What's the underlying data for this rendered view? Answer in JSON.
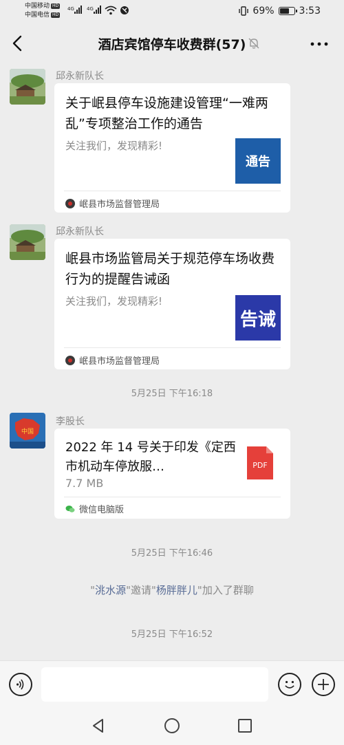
{
  "status": {
    "carrier1": "中国移动",
    "carrier2": "中国电信",
    "hd_badge": "HD",
    "network1": "4G",
    "network2": "4G",
    "vibrate_icon": "vibrate-icon",
    "battery_percent": "69%",
    "battery_level": 0.69,
    "time": "3:53"
  },
  "header": {
    "title": "酒店宾馆停车收费群(57)",
    "back_icon": "chevron-left-icon",
    "mute_icon": "bell-muted-icon",
    "more_icon": "more-dots-icon"
  },
  "messages": [
    {
      "sender": "邱永新队长",
      "title": "关于岷县停车设施建设管理“一难两乱”专项整治工作的通告",
      "desc": "关注我们，发现精彩!",
      "thumb_text": "通告",
      "thumb_color": "#1e5ea8",
      "source": "岷县市场监督管理局"
    },
    {
      "sender": "邱永新队长",
      "title": "岷县市场监管局关于规范停车场收费行为的提醒告诫函",
      "desc": "关注我们，发现精彩!",
      "thumb_text": "告诫",
      "thumb_color": "#2b39a8",
      "source": "岷县市场监督管理局"
    }
  ],
  "timestamps": [
    "5月25日 下午16:18",
    "5月25日 下午16:46",
    "5月25日 下午16:52"
  ],
  "file_message": {
    "sender": "李股长",
    "title": "2022 年 14 号关于印发《定西市机动车停放服…",
    "size": "7.7 MB",
    "file_icon_text": "PDF",
    "file_color": "#e5403a",
    "source": "微信电脑版"
  },
  "system_note": {
    "q1": "\"",
    "inviter": "洮水源",
    "mid": "\"邀请\"",
    "invitee": "杨胖胖儿",
    "tail": "\"加入了群聊"
  },
  "input": {
    "voice_icon": "voice-icon",
    "emoji_icon": "emoji-icon",
    "plus_icon": "plus-icon",
    "value": ""
  },
  "navbar": {
    "back_icon": "nav-back-icon",
    "home_icon": "nav-home-icon",
    "recent_icon": "nav-recent-icon"
  }
}
